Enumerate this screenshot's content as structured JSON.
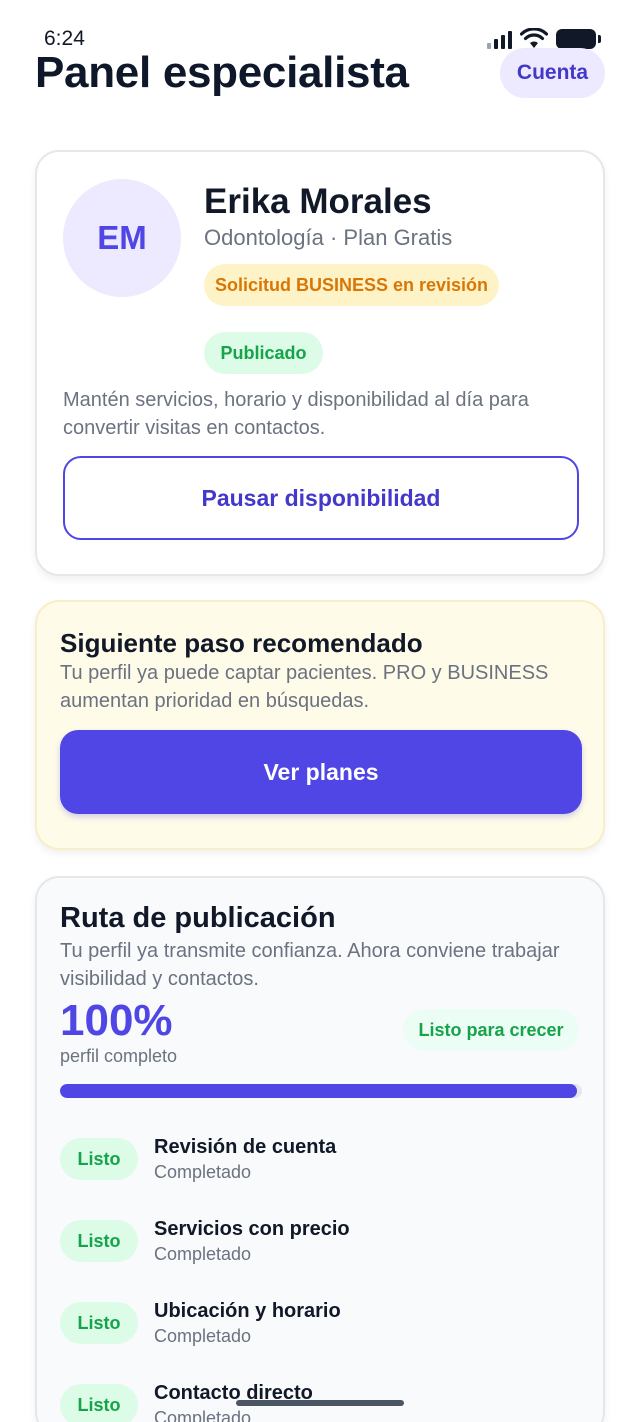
{
  "status_bar": {
    "time": "6:24"
  },
  "header": {
    "title": "Panel especialista",
    "account_label": "Cuenta"
  },
  "profile": {
    "initials": "EM",
    "name": "Erika Morales",
    "subtitle": "Odontología · Plan Gratis",
    "request_badge": "Solicitud BUSINESS en revisión",
    "status_badge": "Publicado",
    "description": "Mantén servicios, horario y disponibilidad al día para convertir visitas en contactos.",
    "pause_button": "Pausar disponibilidad"
  },
  "next_step": {
    "title": "Siguiente paso recomendado",
    "description": "Tu perfil ya puede captar pacientes. PRO y BUSINESS aumentan prioridad en búsquedas.",
    "button": "Ver planes"
  },
  "route": {
    "title": "Ruta de publicación",
    "description": "Tu perfil ya transmite confianza. Ahora conviene trabajar visibilidad y contactos.",
    "percent": "100%",
    "percent_label": "perfil completo",
    "progress": 1.0,
    "ready_badge": "Listo para crecer",
    "steps": [
      {
        "badge": "Listo",
        "title": "Revisión de cuenta",
        "status": "Completado"
      },
      {
        "badge": "Listo",
        "title": "Servicios con precio",
        "status": "Completado"
      },
      {
        "badge": "Listo",
        "title": "Ubicación y horario",
        "status": "Completado"
      },
      {
        "badge": "Listo",
        "title": "Contacto directo",
        "status": "Completado"
      }
    ]
  },
  "colors": {
    "accent": "#4f46e5",
    "warning": "#d97706",
    "success": "#16a34a"
  }
}
